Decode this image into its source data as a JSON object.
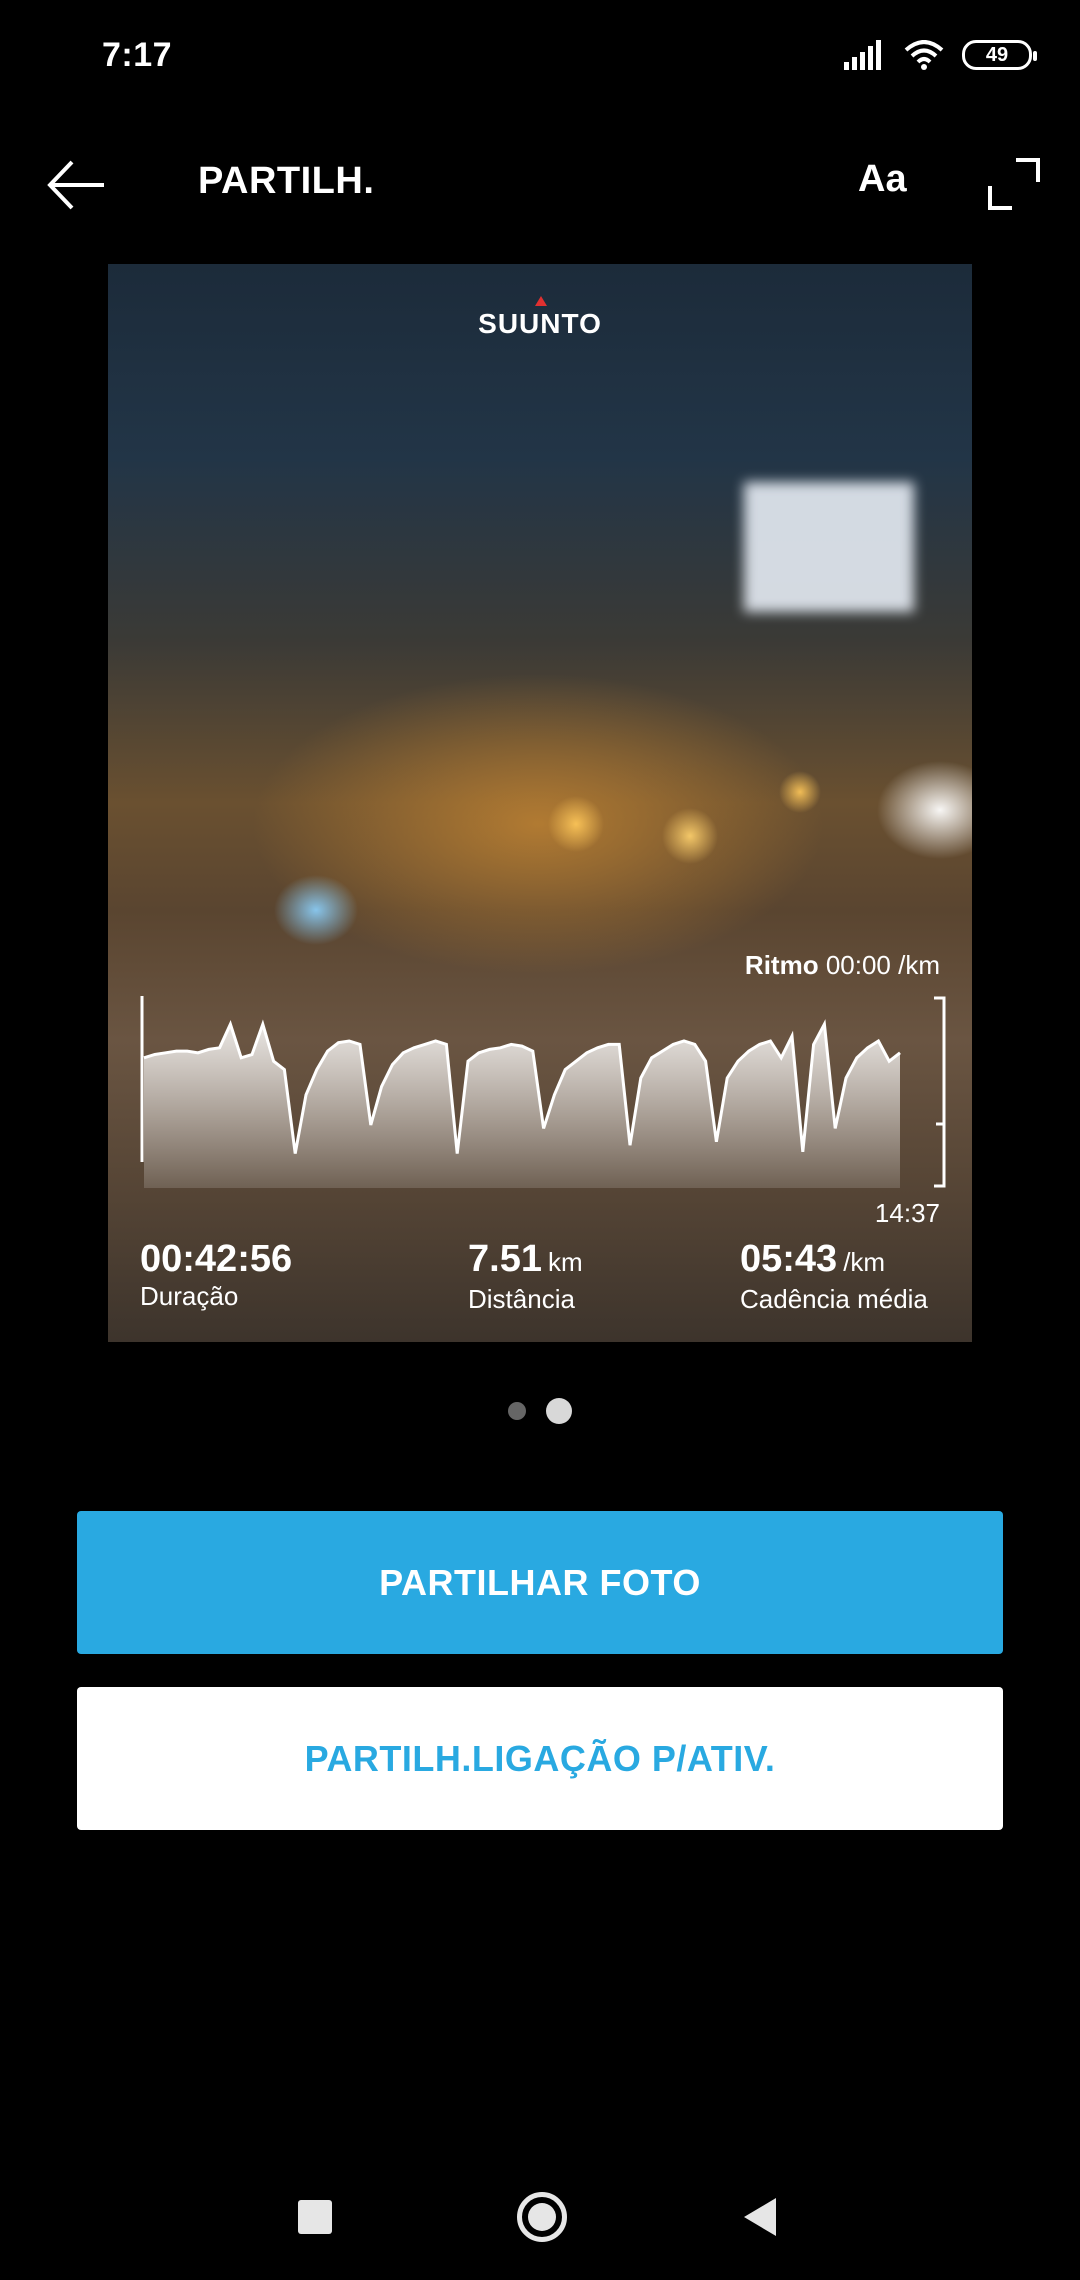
{
  "status_bar": {
    "time": "7:17",
    "battery": "49"
  },
  "app_bar": {
    "title": "PARTILH.",
    "font_button": "Aa"
  },
  "photo_card": {
    "brand": "SUUNTO",
    "metric_name": "Ritmo",
    "metric_value": "00:00 /km",
    "chart_end_time": "14:37",
    "stats": [
      {
        "value": "00:42:56",
        "unit": "",
        "label": "Duração"
      },
      {
        "value": "7.51",
        "unit": "km",
        "label": "Distância"
      },
      {
        "value": "05:43",
        "unit": "/km",
        "label": "Cadência média"
      }
    ]
  },
  "chart_data": {
    "type": "area",
    "title": "",
    "xlabel": "",
    "ylabel": "",
    "x_end_label": "14:37",
    "y_relative": [
      0.62,
      0.64,
      0.65,
      0.66,
      0.66,
      0.65,
      0.67,
      0.68,
      0.82,
      0.62,
      0.64,
      0.82,
      0.6,
      0.55,
      0.05,
      0.4,
      0.55,
      0.66,
      0.71,
      0.72,
      0.7,
      0.22,
      0.45,
      0.58,
      0.65,
      0.68,
      0.7,
      0.72,
      0.7,
      0.05,
      0.6,
      0.65,
      0.67,
      0.68,
      0.7,
      0.69,
      0.66,
      0.2,
      0.4,
      0.55,
      0.6,
      0.65,
      0.68,
      0.7,
      0.7,
      0.1,
      0.5,
      0.62,
      0.66,
      0.7,
      0.72,
      0.7,
      0.6,
      0.12,
      0.5,
      0.6,
      0.66,
      0.7,
      0.72,
      0.62,
      0.75,
      0.06,
      0.7,
      0.82,
      0.2,
      0.5,
      0.62,
      0.68,
      0.72,
      0.6,
      0.65
    ]
  },
  "pager": {
    "count": 2,
    "active": 1
  },
  "buttons": {
    "share_photo": "PARTILHAR FOTO",
    "share_link": "PARTILH.LIGAÇÃO P/ATIV."
  },
  "nav_bar": {
    "recents_icon": "square",
    "home_icon": "circle",
    "back_icon": "triangle"
  }
}
